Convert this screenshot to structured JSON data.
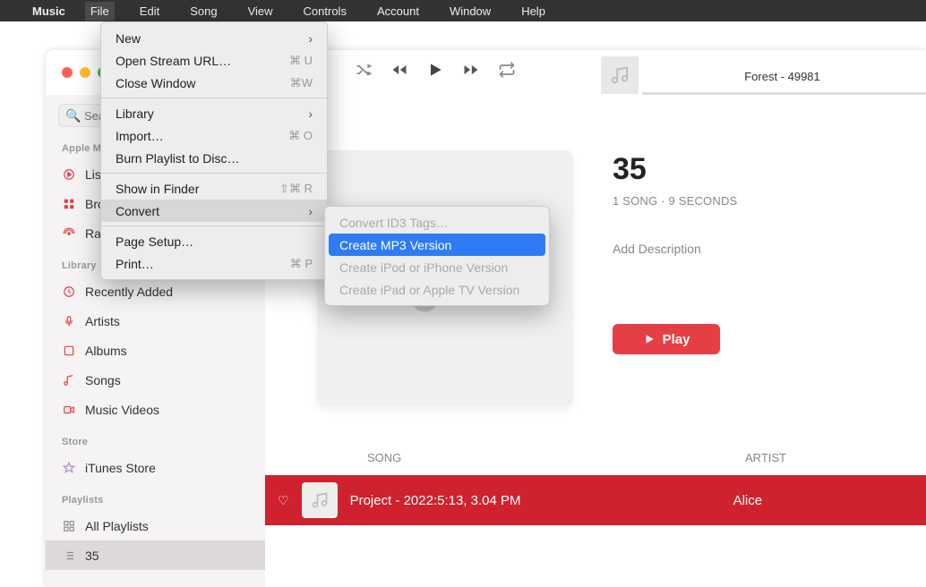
{
  "menubar": {
    "app": "Music",
    "items": [
      "File",
      "Edit",
      "Song",
      "View",
      "Controls",
      "Account",
      "Window",
      "Help"
    ],
    "active_index": 0
  },
  "file_menu": [
    {
      "label": "New",
      "arrow": true
    },
    {
      "label": "Open Stream URL…",
      "shortcut": "⌘ U"
    },
    {
      "label": "Close Window",
      "shortcut": "⌘W"
    },
    {
      "sep": true
    },
    {
      "label": "Library",
      "arrow": true
    },
    {
      "label": "Import…",
      "shortcut": "⌘ O"
    },
    {
      "label": "Burn Playlist to Disc…"
    },
    {
      "sep": true
    },
    {
      "label": "Show in Finder",
      "shortcut": "⇧⌘ R"
    },
    {
      "label": "Convert",
      "arrow": true,
      "hover": true
    },
    {
      "sep": true
    },
    {
      "label": "Page Setup…"
    },
    {
      "label": "Print…",
      "shortcut": "⌘ P"
    }
  ],
  "convert_submenu": [
    {
      "label": "Convert ID3 Tags…",
      "disabled": true
    },
    {
      "label": "Create MP3 Version",
      "highlight": true
    },
    {
      "label": "Create iPod or iPhone Version",
      "disabled": true
    },
    {
      "label": "Create iPad or Apple TV Version",
      "disabled": true
    }
  ],
  "now_playing": {
    "title": "Forest - 49981"
  },
  "search": {
    "placeholder": "Search"
  },
  "sidebar": {
    "sections": [
      {
        "header": "Apple Music",
        "items": [
          {
            "icon": "play-circle",
            "label": "Listen Now"
          },
          {
            "icon": "music-grid",
            "label": "Browse"
          },
          {
            "icon": "radio",
            "label": "Radio"
          }
        ]
      },
      {
        "header": "Library",
        "items": [
          {
            "icon": "clock",
            "label": "Recently Added"
          },
          {
            "icon": "mic",
            "label": "Artists"
          },
          {
            "icon": "album",
            "label": "Albums"
          },
          {
            "icon": "note",
            "label": "Songs"
          },
          {
            "icon": "video",
            "label": "Music Videos"
          }
        ]
      },
      {
        "header": "Store",
        "items": [
          {
            "icon": "star",
            "color": "purple",
            "label": "iTunes Store"
          }
        ]
      },
      {
        "header": "Playlists",
        "items": [
          {
            "icon": "grid",
            "color": "grey",
            "label": "All Playlists"
          },
          {
            "icon": "list",
            "color": "grey",
            "label": "35",
            "selected": true
          }
        ]
      }
    ]
  },
  "album": {
    "title": "35",
    "subtitle": "1 SONG · 9 SECONDS",
    "description": "Add Description",
    "play_label": "Play"
  },
  "table": {
    "headers": {
      "song": "SONG",
      "artist": "ARTIST"
    },
    "rows": [
      {
        "title": "Project - 2022:5:13, 3.04 PM",
        "artist": "Alice"
      }
    ]
  }
}
